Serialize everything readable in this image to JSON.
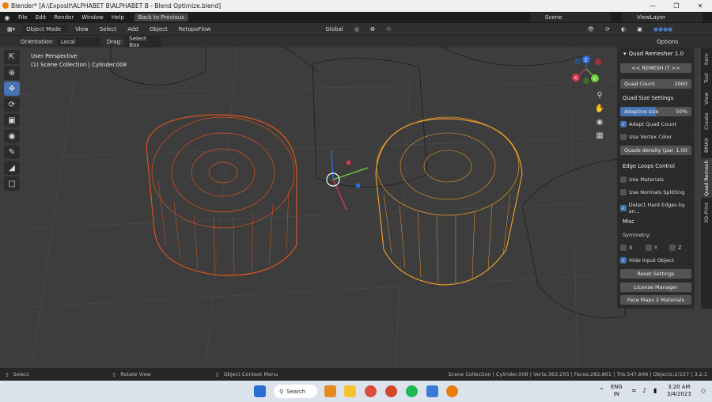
{
  "window": {
    "title": "Blender* [A:\\Exposit\\ALPHABET B\\ALPHABET B - Blend Optimize.blend]"
  },
  "menu": {
    "items": [
      "File",
      "Edit",
      "Render",
      "Window",
      "Help"
    ],
    "back_button": "Back to Previous"
  },
  "scene": {
    "label": "Scene"
  },
  "view_layer": {
    "label": "ViewLayer"
  },
  "header": {
    "mode": "Object Mode",
    "view": "View",
    "select": "Select",
    "add": "Add",
    "object": "Object",
    "retopoflow": "RetopoFlow",
    "transform_orientation": "Global"
  },
  "toolsettings": {
    "orientation_label": "Orientation:",
    "orientation_value": "Local",
    "drag_label": "Drag:",
    "drag_value": "Select Box",
    "options": "Options"
  },
  "viewport": {
    "perspective": "User Perspective",
    "collection": "(1) Scene Collection | Cylinder.008"
  },
  "panel": {
    "title": "Quad Remesher 1.0",
    "remesh_button": "<< REMESH IT >>",
    "quad_count_label": "Quad Count",
    "quad_count_value": "2000",
    "quad_size_section": "Quad Size Settings",
    "adaptive_size_label": "Adaptive size",
    "adaptive_size_value": "50%",
    "adaptive_size_fraction": 0.5,
    "adapt_quad_count": "Adapt Quad Count",
    "use_vertex_color": "Use Vertex Color",
    "quads_density_label": "Quads density (pai",
    "quads_density_value": "1.00",
    "edge_loops_section": "Edge Loops Control",
    "use_materials": "Use Materials",
    "use_normals_splitting": "Use Normals Splitting",
    "detect_hard_edges": "Detect Hard Edges by an...",
    "misc_section": "Misc",
    "symmetry_label": "Symmetry:",
    "sym_x": "X",
    "sym_y": "Y",
    "sym_z": "Z",
    "hide_input": "Hide Input Object",
    "reset_button": "Reset Settings",
    "license_button": "License Manager",
    "facemaps_button": "Face Maps 2 Materials"
  },
  "sidebar_tabs": [
    "Item",
    "Tool",
    "View",
    "Create",
    "BMAX",
    "Quad Remesh",
    "3D-Print"
  ],
  "gizmo": {
    "x": "X",
    "y": "Y",
    "z": "Z"
  },
  "statusbar": {
    "select": "Select",
    "rotate": "Rotate View",
    "context": "Object Context Menu",
    "stats": "Scene Collection | Cylinder.008 | Verts:363,205 | Faces:282,861 | Tris:547,846 | Objects:2/157 | 3.2.1"
  },
  "taskbar": {
    "search": "Search",
    "lang1": "ENG",
    "lang2": "IN",
    "time": "3:20 AM",
    "date": "3/4/2023"
  },
  "colors": {
    "accent": "#4772b3",
    "orange_mesh": "#d9541a",
    "yellow_mesh": "#e69a2a"
  }
}
